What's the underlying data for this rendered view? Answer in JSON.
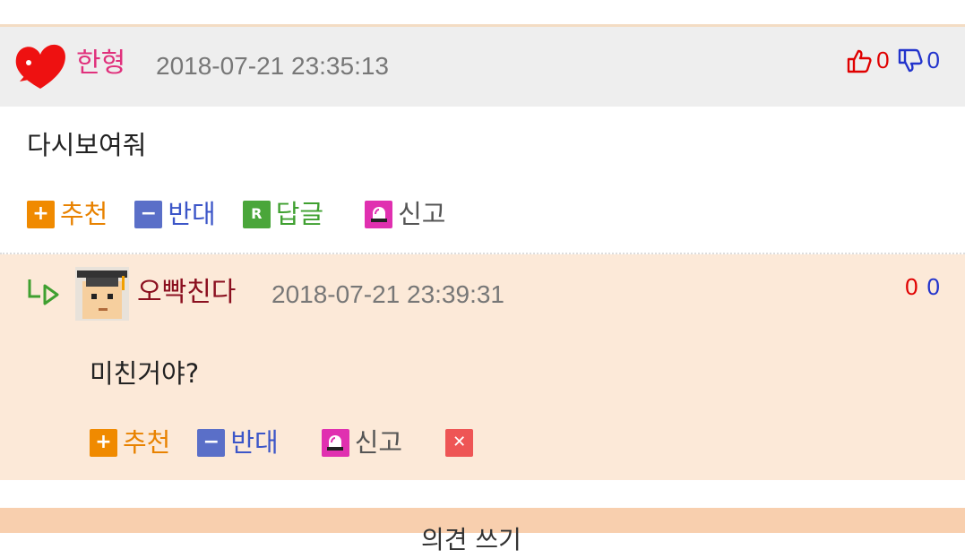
{
  "comment": {
    "author": "한형",
    "date": "2018-07-21 23:35:13",
    "up_count": "0",
    "down_count": "0",
    "body": "다시보여줘",
    "actions": {
      "recommend": "추천",
      "oppose": "반대",
      "reply": "답글",
      "report": "신고"
    },
    "icons": {
      "author_badge": "heart-icon",
      "up": "thumbs-up-icon",
      "down": "thumbs-down-icon"
    }
  },
  "reply": {
    "author": "오빡친다",
    "date": "2018-07-21 23:39:31",
    "up_count": "0",
    "down_count": "0",
    "body": "미친거야?",
    "actions": {
      "recommend": "추천",
      "oppose": "반대",
      "report": "신고"
    },
    "icons": {
      "indent": "reply-arrow-icon",
      "avatar": "graduate-avatar-icon",
      "delete": "close-icon"
    }
  },
  "bottom_bar": {
    "label": "의견 쓰기"
  },
  "colors": {
    "header_bg": "#eeeeee",
    "reply_bg": "#fce9d8",
    "author1": "#e0307c",
    "author2": "#8b1020",
    "up": "#e00000",
    "down": "#2233cc",
    "bottom_bar": "#f8cfae"
  }
}
